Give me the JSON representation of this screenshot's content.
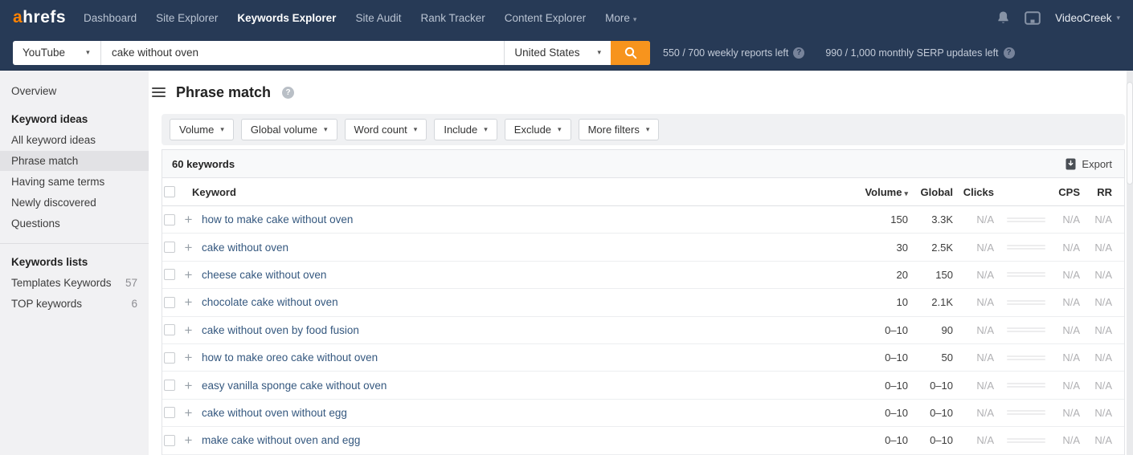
{
  "colors": {
    "nav_bg": "#273a56",
    "accent_orange": "#f7941d",
    "link": "#35587f",
    "sidebar_selected": "#e2e2e5"
  },
  "nav": {
    "logo_a": "a",
    "logo_rest": "hrefs",
    "items": [
      {
        "label": "Dashboard"
      },
      {
        "label": "Site Explorer"
      },
      {
        "label": "Keywords Explorer",
        "active": true
      },
      {
        "label": "Site Audit"
      },
      {
        "label": "Rank Tracker"
      },
      {
        "label": "Content Explorer"
      },
      {
        "label": "More",
        "caret": "▾"
      }
    ],
    "account": {
      "label": "VideoCreek",
      "caret": "▾"
    }
  },
  "search": {
    "target": "YouTube",
    "target_caret": "▾",
    "query": "cake without oven",
    "country": "United States",
    "country_caret": "▾",
    "weekly_reports": "550 / 700 weekly reports left",
    "serp_updates": "990 / 1,000 monthly SERP updates left",
    "help_glyph": "?"
  },
  "sidebar": {
    "items": [
      {
        "label": "Overview",
        "type": "link"
      },
      {
        "label": "Keyword ideas",
        "type": "header"
      },
      {
        "label": "All keyword ideas",
        "type": "link"
      },
      {
        "label": "Phrase match",
        "type": "link",
        "active": true
      },
      {
        "label": "Having same terms",
        "type": "link"
      },
      {
        "label": "Newly discovered",
        "type": "link"
      },
      {
        "label": "Questions",
        "type": "link"
      },
      {
        "type": "divider"
      },
      {
        "label": "Keywords lists",
        "type": "header"
      },
      {
        "label": "Templates Keywords",
        "type": "link",
        "count": "57"
      },
      {
        "label": "TOP keywords",
        "type": "link",
        "count": "6"
      }
    ]
  },
  "main": {
    "title": "Phrase match",
    "title_help_glyph": "?",
    "filters": [
      {
        "label": "Volume",
        "caret": "▾"
      },
      {
        "label": "Global volume",
        "caret": "▾"
      },
      {
        "label": "Word count",
        "caret": "▾"
      },
      {
        "label": "Include",
        "caret": "▾"
      },
      {
        "label": "Exclude",
        "caret": "▾"
      },
      {
        "label": "More filters",
        "caret": "▾"
      }
    ],
    "results_count": "60 keywords",
    "export_label": "Export",
    "table": {
      "headers": {
        "keyword": "Keyword",
        "volume": "Volume",
        "sort_caret": "▾",
        "global": "Global",
        "clicks": "Clicks",
        "cps": "CPS",
        "rr": "RR"
      },
      "rows": [
        {
          "keyword": "how to make cake without oven",
          "volume": "150",
          "global": "3.3K",
          "clicks": "N/A",
          "cps": "N/A",
          "rr": "N/A"
        },
        {
          "keyword": "cake without oven",
          "volume": "30",
          "global": "2.5K",
          "clicks": "N/A",
          "cps": "N/A",
          "rr": "N/A"
        },
        {
          "keyword": "cheese cake without oven",
          "volume": "20",
          "global": "150",
          "clicks": "N/A",
          "cps": "N/A",
          "rr": "N/A"
        },
        {
          "keyword": "chocolate cake without oven",
          "volume": "10",
          "global": "2.1K",
          "clicks": "N/A",
          "cps": "N/A",
          "rr": "N/A"
        },
        {
          "keyword": "cake without oven by food fusion",
          "volume": "0–10",
          "global": "90",
          "clicks": "N/A",
          "cps": "N/A",
          "rr": "N/A"
        },
        {
          "keyword": "how to make oreo cake without oven",
          "volume": "0–10",
          "global": "50",
          "clicks": "N/A",
          "cps": "N/A",
          "rr": "N/A"
        },
        {
          "keyword": "easy vanilla sponge cake without oven",
          "volume": "0–10",
          "global": "0–10",
          "clicks": "N/A",
          "cps": "N/A",
          "rr": "N/A"
        },
        {
          "keyword": "cake without oven without egg",
          "volume": "0–10",
          "global": "0–10",
          "clicks": "N/A",
          "cps": "N/A",
          "rr": "N/A"
        },
        {
          "keyword": "make cake without oven and egg",
          "volume": "0–10",
          "global": "0–10",
          "clicks": "N/A",
          "cps": "N/A",
          "rr": "N/A"
        }
      ]
    }
  }
}
